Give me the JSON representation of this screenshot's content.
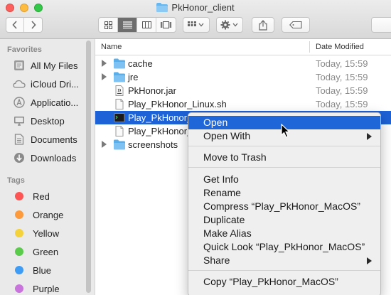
{
  "window": {
    "title": "PkHonor_client",
    "colors": {
      "accent": "#1d62d6",
      "folder": "#66b7f0"
    }
  },
  "toolbar": {
    "back_icon": "chevron-left-icon",
    "forward_icon": "chevron-right-icon",
    "view_modes": [
      "icon-view-icon",
      "list-view-icon",
      "column-view-icon",
      "gallery-view-icon"
    ],
    "active_view": "list",
    "arrange_icon": "grid-arrange-icon",
    "action_icon": "gear-icon",
    "share_icon": "share-icon",
    "tag_icon": "tag-icon"
  },
  "sidebar": {
    "favorites_header": "Favorites",
    "favorites": [
      {
        "label": "All My Files",
        "icon": "all-files-icon"
      },
      {
        "label": "iCloud Dri...",
        "icon": "cloud-icon"
      },
      {
        "label": "Applicatio...",
        "icon": "applications-icon"
      },
      {
        "label": "Desktop",
        "icon": "desktop-icon"
      },
      {
        "label": "Documents",
        "icon": "documents-icon"
      },
      {
        "label": "Downloads",
        "icon": "downloads-icon"
      }
    ],
    "tags_header": "Tags",
    "tags": [
      {
        "label": "Red",
        "color": "#fd5454"
      },
      {
        "label": "Orange",
        "color": "#fd9a3c"
      },
      {
        "label": "Yellow",
        "color": "#f3d23c"
      },
      {
        "label": "Green",
        "color": "#5acb4a"
      },
      {
        "label": "Blue",
        "color": "#3f9cf4"
      },
      {
        "label": "Purple",
        "color": "#c874dc"
      }
    ]
  },
  "list": {
    "columns": {
      "name": "Name",
      "date": "Date Modified"
    },
    "rows": [
      {
        "name": "cache",
        "date": "Today, 15:59",
        "kind": "folder"
      },
      {
        "name": "jre",
        "date": "Today, 15:59",
        "kind": "folder"
      },
      {
        "name": "PkHonor.jar",
        "date": "Today, 15:59",
        "kind": "jar"
      },
      {
        "name": "Play_PkHonor_Linux.sh",
        "date": "Today, 15:59",
        "kind": "file"
      },
      {
        "name": "Play_PkHonor_",
        "date": "",
        "kind": "exec",
        "selected": true
      },
      {
        "name": "Play_PkHonor_W",
        "date": "",
        "kind": "file"
      },
      {
        "name": "screenshots",
        "date": "",
        "kind": "folder"
      }
    ]
  },
  "context_menu": {
    "items": [
      {
        "label": "Open",
        "highlighted": true
      },
      {
        "label": "Open With",
        "submenu": true
      },
      {
        "separator": true
      },
      {
        "label": "Move to Trash"
      },
      {
        "separator": true
      },
      {
        "label": "Get Info"
      },
      {
        "label": "Rename"
      },
      {
        "label": "Compress “Play_PkHonor_MacOS”"
      },
      {
        "label": "Duplicate"
      },
      {
        "label": "Make Alias"
      },
      {
        "label": "Quick Look “Play_PkHonor_MacOS”"
      },
      {
        "label": "Share",
        "submenu": true
      },
      {
        "separator": true
      },
      {
        "label": "Copy “Play_PkHonor_MacOS”"
      }
    ]
  }
}
